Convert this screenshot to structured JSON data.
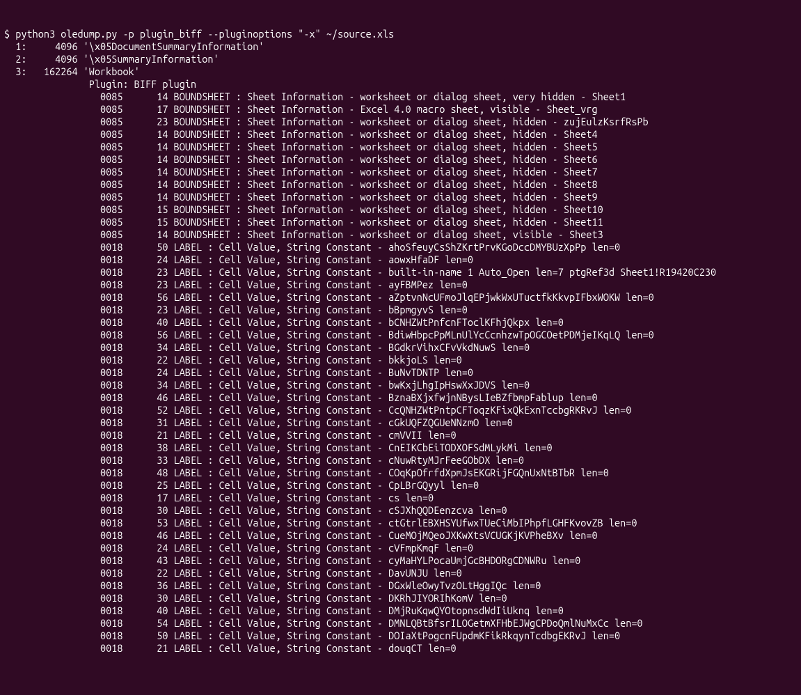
{
  "prompt": "$ ",
  "command": "python3 oledump.py -p plugin_biff --pluginoptions \"-x\" ~/source.xls",
  "streams": [
    {
      "idx": "1",
      "size": "4096",
      "name": "'\\x05DocumentSummaryInformation'"
    },
    {
      "idx": "2",
      "size": "4096",
      "name": "'\\x05SummaryInformation'"
    },
    {
      "idx": "3",
      "size": "162264",
      "name": "'Workbook'"
    }
  ],
  "plugin_header": "               Plugin: BIFF plugin",
  "records": [
    {
      "code": "0085",
      "len": "14",
      "text": "BOUNDSHEET : Sheet Information - worksheet or dialog sheet, very hidden - Sheet1"
    },
    {
      "code": "0085",
      "len": "17",
      "text": "BOUNDSHEET : Sheet Information - Excel 4.0 macro sheet, visible - Sheet_vrg"
    },
    {
      "code": "0085",
      "len": "23",
      "text": "BOUNDSHEET : Sheet Information - worksheet or dialog sheet, hidden - zujEulzKsrfRsPb"
    },
    {
      "code": "0085",
      "len": "14",
      "text": "BOUNDSHEET : Sheet Information - worksheet or dialog sheet, hidden - Sheet4"
    },
    {
      "code": "0085",
      "len": "14",
      "text": "BOUNDSHEET : Sheet Information - worksheet or dialog sheet, hidden - Sheet5"
    },
    {
      "code": "0085",
      "len": "14",
      "text": "BOUNDSHEET : Sheet Information - worksheet or dialog sheet, hidden - Sheet6"
    },
    {
      "code": "0085",
      "len": "14",
      "text": "BOUNDSHEET : Sheet Information - worksheet or dialog sheet, hidden - Sheet7"
    },
    {
      "code": "0085",
      "len": "14",
      "text": "BOUNDSHEET : Sheet Information - worksheet or dialog sheet, hidden - Sheet8"
    },
    {
      "code": "0085",
      "len": "14",
      "text": "BOUNDSHEET : Sheet Information - worksheet or dialog sheet, hidden - Sheet9"
    },
    {
      "code": "0085",
      "len": "15",
      "text": "BOUNDSHEET : Sheet Information - worksheet or dialog sheet, hidden - Sheet10"
    },
    {
      "code": "0085",
      "len": "15",
      "text": "BOUNDSHEET : Sheet Information - worksheet or dialog sheet, hidden - Sheet11"
    },
    {
      "code": "0085",
      "len": "14",
      "text": "BOUNDSHEET : Sheet Information - worksheet or dialog sheet, visible - Sheet3"
    },
    {
      "code": "0018",
      "len": "50",
      "text": "LABEL : Cell Value, String Constant - ahoSfeuyCsShZKrtPrvKGoDccDMYBUzXpPp len=0"
    },
    {
      "code": "0018",
      "len": "24",
      "text": "LABEL : Cell Value, String Constant - aowxHfaDF len=0"
    },
    {
      "code": "0018",
      "len": "23",
      "text": "LABEL : Cell Value, String Constant - built-in-name 1 Auto_Open len=7 ptgRef3d Sheet1!R19420C230"
    },
    {
      "code": "0018",
      "len": "23",
      "text": "LABEL : Cell Value, String Constant - ayFBMPez len=0"
    },
    {
      "code": "0018",
      "len": "56",
      "text": "LABEL : Cell Value, String Constant - aZptvnNcUFmoJlqEPjwkWxUTuctfkKkvpIFbxWOKW len=0"
    },
    {
      "code": "0018",
      "len": "23",
      "text": "LABEL : Cell Value, String Constant - bBpmgyvS len=0"
    },
    {
      "code": "0018",
      "len": "40",
      "text": "LABEL : Cell Value, String Constant - bCNHZWtPnfcnFToclKFhjQkpx len=0"
    },
    {
      "code": "0018",
      "len": "56",
      "text": "LABEL : Cell Value, String Constant - BdiwHbpcPpMLnUlYcCcnhzwTpOGCOetPDMjeIKqLQ len=0"
    },
    {
      "code": "0018",
      "len": "34",
      "text": "LABEL : Cell Value, String Constant - BGdkrVihxCFvVkdNuwS len=0"
    },
    {
      "code": "0018",
      "len": "22",
      "text": "LABEL : Cell Value, String Constant - bkkjoLS len=0"
    },
    {
      "code": "0018",
      "len": "24",
      "text": "LABEL : Cell Value, String Constant - BuNvTDNTP len=0"
    },
    {
      "code": "0018",
      "len": "34",
      "text": "LABEL : Cell Value, String Constant - bwKxjLhgIpHswXxJDVS len=0"
    },
    {
      "code": "0018",
      "len": "46",
      "text": "LABEL : Cell Value, String Constant - BznaBXjxfwjnNBysLIeBZfbmpFablup len=0"
    },
    {
      "code": "0018",
      "len": "52",
      "text": "LABEL : Cell Value, String Constant - CcQNHZWtPntpCFToqzKFixQkExnTccbgRKRvJ len=0"
    },
    {
      "code": "0018",
      "len": "31",
      "text": "LABEL : Cell Value, String Constant - cGkUQFZQGUeNNzmO len=0"
    },
    {
      "code": "0018",
      "len": "21",
      "text": "LABEL : Cell Value, String Constant - cmVVII len=0"
    },
    {
      "code": "0018",
      "len": "38",
      "text": "LABEL : Cell Value, String Constant - CnEIKCbEiTODXOFSdMLykMi len=0"
    },
    {
      "code": "0018",
      "len": "33",
      "text": "LABEL : Cell Value, String Constant - cNuwRtyMJrFeeGObDX len=0"
    },
    {
      "code": "0018",
      "len": "48",
      "text": "LABEL : Cell Value, String Constant - COqKpOfrfdXpmJsEKGRijFGQnUxNtBTbR len=0"
    },
    {
      "code": "0018",
      "len": "25",
      "text": "LABEL : Cell Value, String Constant - CpLBrGQyyl len=0"
    },
    {
      "code": "0018",
      "len": "17",
      "text": "LABEL : Cell Value, String Constant - cs len=0"
    },
    {
      "code": "0018",
      "len": "30",
      "text": "LABEL : Cell Value, String Constant - cSJXhQQDEenzcva len=0"
    },
    {
      "code": "0018",
      "len": "53",
      "text": "LABEL : Cell Value, String Constant - ctGtrlEBXHSYUfwxTUeCiMbIPhpfLGHFKvovZB len=0"
    },
    {
      "code": "0018",
      "len": "46",
      "text": "LABEL : Cell Value, String Constant - CueMOjMQeoJXKwXtsVCUGKjKVPheBXv len=0"
    },
    {
      "code": "0018",
      "len": "24",
      "text": "LABEL : Cell Value, String Constant - cVFmpKmqF len=0"
    },
    {
      "code": "0018",
      "len": "43",
      "text": "LABEL : Cell Value, String Constant - cyMaHYLPocaUmjGcBHDORgCDNWRu len=0"
    },
    {
      "code": "0018",
      "len": "22",
      "text": "LABEL : Cell Value, String Constant - DavUNJU len=0"
    },
    {
      "code": "0018",
      "len": "36",
      "text": "LABEL : Cell Value, String Constant - DGxWleOwyTvzOLtHggIQc len=0"
    },
    {
      "code": "0018",
      "len": "30",
      "text": "LABEL : Cell Value, String Constant - DKRhJIYORIhKomV len=0"
    },
    {
      "code": "0018",
      "len": "40",
      "text": "LABEL : Cell Value, String Constant - DMjRuKqwQYOtopnsdWdIiUknq len=0"
    },
    {
      "code": "0018",
      "len": "54",
      "text": "LABEL : Cell Value, String Constant - DMNLQBtBfsrILOGetmXFHbEJWgCPDoQmlNuMxCc len=0"
    },
    {
      "code": "0018",
      "len": "50",
      "text": "LABEL : Cell Value, String Constant - DOIaXtPogcnFUpdmKFikRkqynTcdbgEKRvJ len=0"
    },
    {
      "code": "0018",
      "len": "21",
      "text": "LABEL : Cell Value, String Constant - douqCT len=0"
    }
  ]
}
